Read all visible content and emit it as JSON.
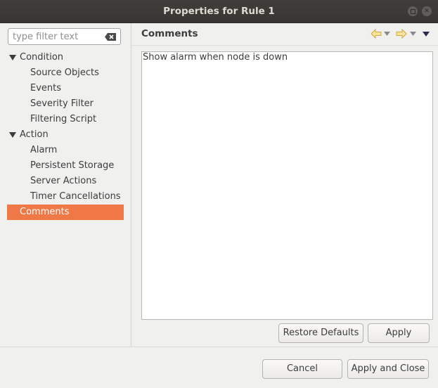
{
  "window": {
    "title": "Properties for Rule 1"
  },
  "filter": {
    "placeholder": "type filter text"
  },
  "tree": {
    "condition": {
      "label": "Condition",
      "children": [
        "Source Objects",
        "Events",
        "Severity Filter",
        "Filtering Script"
      ]
    },
    "action": {
      "label": "Action",
      "children": [
        "Alarm",
        "Persistent Storage",
        "Server Actions",
        "Timer Cancellations"
      ]
    },
    "comments": {
      "label": "Comments",
      "selected": true
    }
  },
  "page": {
    "title": "Comments",
    "comment_text": "Show alarm when node is down"
  },
  "buttons": {
    "restore_defaults": "Restore Defaults",
    "apply": "Apply",
    "cancel": "Cancel",
    "apply_and_close": "Apply and Close"
  },
  "colors": {
    "selection": "#f07746",
    "titlebar": "#3c3b37",
    "nav_arrow": "#f0c44a"
  },
  "icons": [
    "maximize-icon",
    "close-icon",
    "clear-filter-icon",
    "expand-triangle-icon",
    "back-arrow-icon",
    "forward-arrow-icon",
    "dropdown-icon",
    "view-menu-icon"
  ]
}
